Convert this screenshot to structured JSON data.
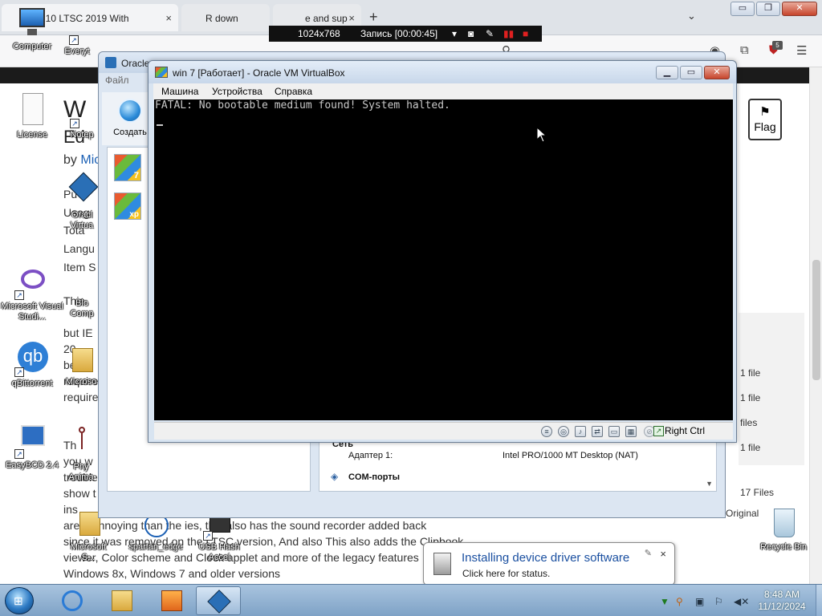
{
  "browser": {
    "tabs": [
      {
        "title": "ows 10 LTSC 2019 With",
        "close": "×"
      },
      {
        "title": "R down",
        "close": "×"
      },
      {
        "title": "e and sup",
        "close": "×"
      }
    ],
    "new_tab": "+",
    "tab_list": "⌄",
    "window_buttons": [
      "▭",
      "❐",
      "✕"
    ],
    "extension_badge": "5"
  },
  "recorder": {
    "resolution": "1024x768",
    "recording": "Запись [00:00:45]"
  },
  "article": {
    "title_line1": "W",
    "title_line2": "Ed",
    "byline_prefix": "by",
    "byline_author": "Mic",
    "meta_lines": [
      "Pu",
      "Usag",
      "Tota",
      "Langu",
      "Item S"
    ],
    "para1": [
      "This",
      "but IE",
      "20",
      "bet",
      "require",
      "require"
    ],
    "para2": [
      "Th",
      "you w",
      "trouble",
      "show t",
      "ins"
    ],
    "line_a": "are       e annoying than the       ies, this also has the sound recorder added back",
    "line_b": "since it was removed on the LTSC version, And also This also adds the Clipbook",
    "line_c": "viewer, Color scheme and Clock applet and more of the legacy features",
    "line_d": "Windows 8x, Windows 7 and older versions",
    "flag_label": "Flag",
    "file_counts": [
      "1 file",
      "1 file",
      "files",
      "1 file"
    ],
    "files_total": "17 Files",
    "original": "Original"
  },
  "desktop_icons": [
    {
      "label": "Computer"
    },
    {
      "label": "Everyt"
    },
    {
      "label": "License"
    },
    {
      "label": "Notep"
    },
    {
      "label": "Oracl Virtua"
    },
    {
      "label": "Microsoft Visual Studi..."
    },
    {
      "label": "Blo Comp"
    },
    {
      "label": "qBittorrent"
    },
    {
      "label": "Microso"
    },
    {
      "label": "EasyBCD 2.4"
    },
    {
      "label": "Phy Anima"
    },
    {
      "label": "Microsoft S..."
    },
    {
      "label": "spartan_edge"
    },
    {
      "label": "USB Hash Accel"
    },
    {
      "label": "Recycle Bin"
    }
  ],
  "vbox_manager": {
    "title": "Oracle",
    "menu": "Файл",
    "create_label": "Создать",
    "vm_badges": [
      "7",
      "xp"
    ],
    "details": {
      "network_header": "Сеть",
      "adapter_label": "Адаптер 1:",
      "adapter_value": "Intel PRO/1000 MT Desktop (NAT)",
      "com_header": "COM-порты"
    }
  },
  "vm_window": {
    "title": "win 7 [Работает] - Oracle VM VirtualBox",
    "menu": [
      "Машина",
      "Устройства",
      "Справка"
    ],
    "screen_text": "FATAL: No bootable medium found! System halted.",
    "host_key": "Right Ctrl"
  },
  "notification": {
    "title": "Installing device driver software",
    "subtitle": "Click here for status.",
    "close": "×"
  },
  "taskbar": {
    "time": "8:48 AM",
    "date": "11/12/2024"
  }
}
